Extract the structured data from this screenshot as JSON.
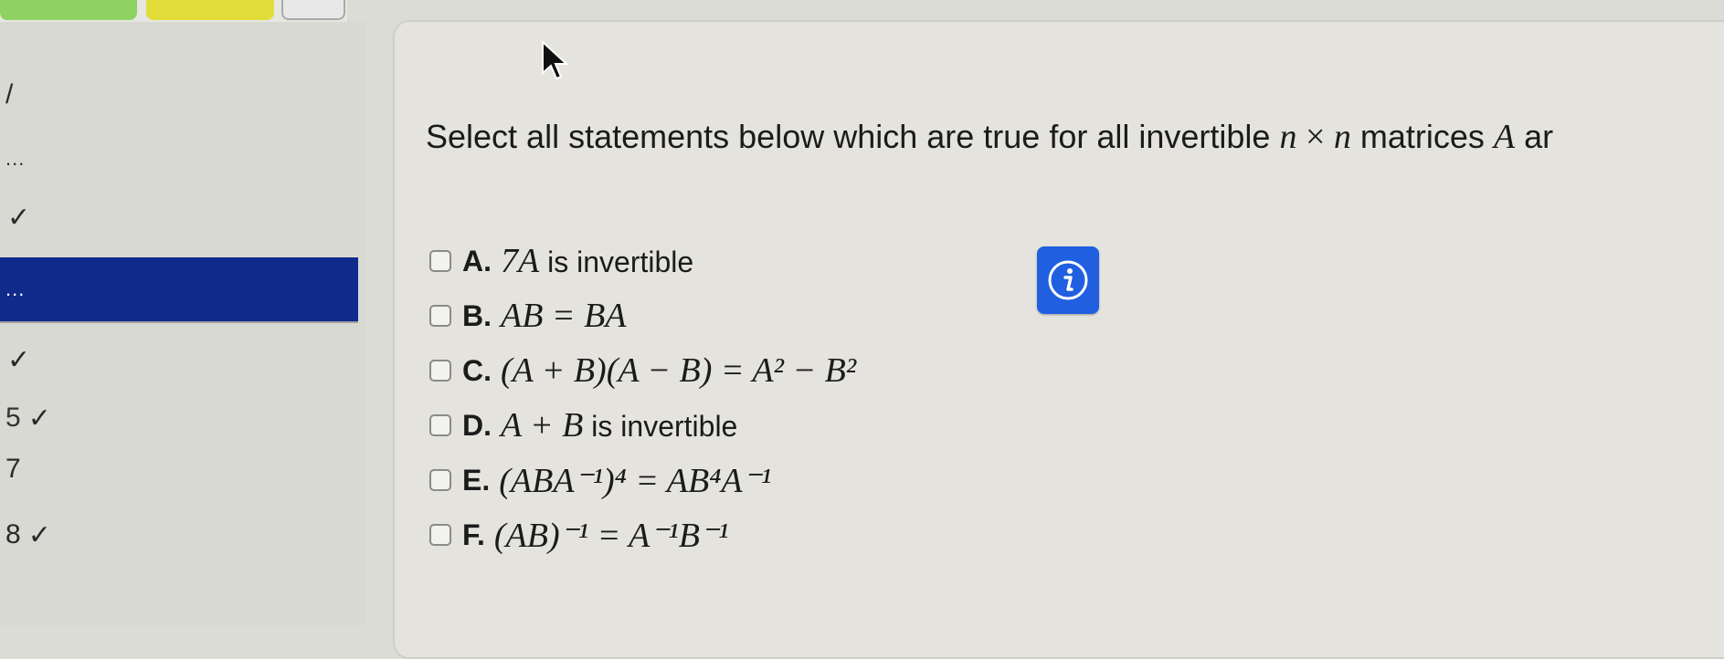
{
  "progress_swatches": [
    "green",
    "yellow",
    "gray"
  ],
  "colors": {
    "active_item": "#0f2a8a",
    "info_button": "#1f5fe0",
    "swatch_green": "#8fd163",
    "swatch_yellow": "#e3dd3a"
  },
  "sidebar": {
    "items": [
      {
        "label": "/",
        "status": ""
      },
      {
        "label": "...",
        "status": ""
      },
      {
        "label": "",
        "status": "✓"
      },
      {
        "label": "...",
        "status": "",
        "active": true
      },
      {
        "label": "",
        "status": "✓"
      },
      {
        "label": "5",
        "status": "✓"
      },
      {
        "label": "7",
        "status": ""
      },
      {
        "label": "8",
        "status": "✓"
      }
    ]
  },
  "question": {
    "prompt_prefix": "Select all statements below which are true for all invertible ",
    "prompt_n1": "n",
    "prompt_times": " × ",
    "prompt_n2": "n",
    "prompt_mid": " matrices ",
    "prompt_A": "A",
    "prompt_suffix": " ar"
  },
  "options": [
    {
      "letter": "A.",
      "text_math": "7A",
      "text_plain": " is invertible"
    },
    {
      "letter": "B.",
      "text_math": "AB = BA",
      "text_plain": ""
    },
    {
      "letter": "C.",
      "text_math": "(A + B)(A − B) = A² − B²",
      "text_plain": ""
    },
    {
      "letter": "D.",
      "text_math": "A + B",
      "text_plain": " is invertible"
    },
    {
      "letter": "E.",
      "text_math": "(ABA⁻¹)⁴ = AB⁴A⁻¹",
      "text_plain": ""
    },
    {
      "letter": "F.",
      "text_math": "(AB)⁻¹ = A⁻¹B⁻¹",
      "text_plain": ""
    }
  ],
  "info_icon": "info-icon",
  "cursor_icon": "cursor-arrow-icon"
}
